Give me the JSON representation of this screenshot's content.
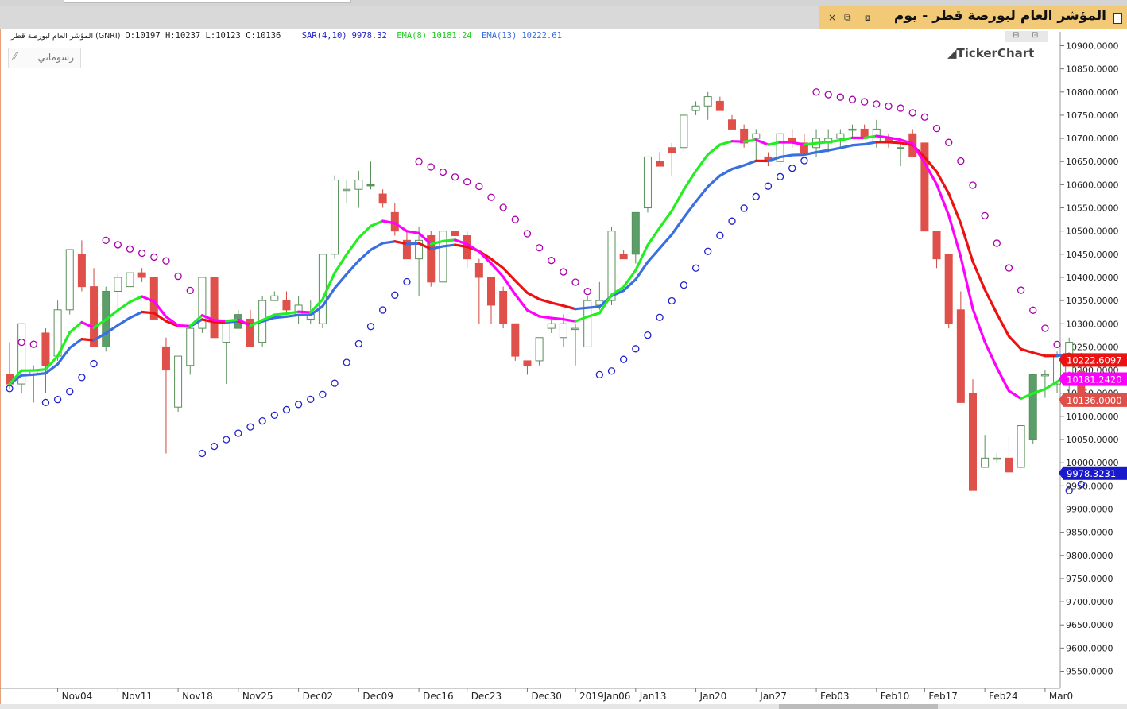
{
  "window": {
    "title": "المؤشر العام لبورصة قطر - يوم",
    "controls": [
      "×",
      "⧉",
      "⧈",
      "⊟",
      "⊡"
    ]
  },
  "legend": {
    "instrument": "المؤشر العام لبورصة قطر (GNRI)",
    "ohlc": "O:10197  H:10237  L:10123  C:10136",
    "sar_label": "SAR(4,10)",
    "sar_value": "9978.32",
    "ema8_label": "EMA(8)",
    "ema8_value": "10181.24",
    "ema13_label": "EMA(13)",
    "ema13_value": "10222.61"
  },
  "toolbar": {
    "drawings_label": "رسوماتي",
    "drawings_icon": "trend-line-icon"
  },
  "brand": "TickerChart",
  "colors": {
    "up_candle": "#2e8b2e",
    "down_candle": "#e0504a",
    "ema8_rising": "#22ee22",
    "ema8_falling": "#ff00ff",
    "ema13_rising": "#3a6fe0",
    "ema13_falling": "#ee1111",
    "sar_below": "#2020cc",
    "sar_above": "#aa00aa"
  },
  "chart_data": {
    "type": "candlestick",
    "title": "المؤشر العام لبورصة قطر - يوم",
    "y_axis_side": "right",
    "ylim": [
      9520,
      10930
    ],
    "y_ticks": [
      10900,
      10850,
      10800,
      10750,
      10700,
      10650,
      10600,
      10550,
      10500,
      10450,
      10400,
      10350,
      10300,
      10250,
      10200,
      10150,
      10100,
      10050,
      10000,
      9950,
      9900,
      9850,
      9800,
      9750,
      9700,
      9650,
      9600,
      9550
    ],
    "x_ticks": [
      {
        "label": "Nov04",
        "bar": 4.5
      },
      {
        "label": "Nov11",
        "bar": 9.5
      },
      {
        "label": "Nov18",
        "bar": 14.5
      },
      {
        "label": "Nov25",
        "bar": 19.5
      },
      {
        "label": "Dec02",
        "bar": 24.5
      },
      {
        "label": "Dec09",
        "bar": 29.5
      },
      {
        "label": "Dec16",
        "bar": 34.5
      },
      {
        "label": "Dec23",
        "bar": 38.5
      },
      {
        "label": "Dec30",
        "bar": 43.5
      },
      {
        "label": "2019Jan06",
        "bar": 47.5
      },
      {
        "label": "Jan13",
        "bar": 52.5
      },
      {
        "label": "Jan20",
        "bar": 57.5
      },
      {
        "label": "Jan27",
        "bar": 62.5
      },
      {
        "label": "Feb03",
        "bar": 67.5
      },
      {
        "label": "Feb10",
        "bar": 72.5
      },
      {
        "label": "Feb17",
        "bar": 76.5
      },
      {
        "label": "Feb24",
        "bar": 81.5
      },
      {
        "label": "Mar0",
        "bar": 86.5
      }
    ],
    "candles": [
      [
        10190,
        10260,
        10160,
        10170
      ],
      [
        10170,
        10300,
        10150,
        10300
      ],
      [
        10190,
        10210,
        10130,
        10200
      ],
      [
        10280,
        10290,
        10150,
        10210
      ],
      [
        10230,
        10350,
        10220,
        10330
      ],
      [
        10330,
        10460,
        10320,
        10460
      ],
      [
        10450,
        10480,
        10370,
        10380
      ],
      [
        10380,
        10420,
        10250,
        10250
      ],
      [
        10250,
        10380,
        10240,
        10370
      ],
      [
        10370,
        10410,
        10330,
        10400
      ],
      [
        10380,
        10400,
        10370,
        10410
      ],
      [
        10410,
        10420,
        10390,
        10400
      ],
      [
        10400,
        10400,
        10310,
        10310
      ],
      [
        10250,
        10270,
        10020,
        10200
      ],
      [
        10120,
        10230,
        10110,
        10230
      ],
      [
        10210,
        10300,
        10190,
        10290
      ],
      [
        10290,
        10400,
        10280,
        10400
      ],
      [
        10400,
        10400,
        10270,
        10270
      ],
      [
        10260,
        10300,
        10170,
        10300
      ],
      [
        10290,
        10330,
        10290,
        10320
      ],
      [
        10310,
        10330,
        10250,
        10250
      ],
      [
        10260,
        10360,
        10250,
        10350
      ],
      [
        10350,
        10370,
        10350,
        10360
      ],
      [
        10350,
        10370,
        10320,
        10330
      ],
      [
        10320,
        10360,
        10300,
        10340
      ],
      [
        10310,
        10350,
        10300,
        10320
      ],
      [
        10300,
        10400,
        10290,
        10450
      ],
      [
        10450,
        10620,
        10440,
        10610
      ],
      [
        10590,
        10610,
        10560,
        10590
      ],
      [
        10590,
        10630,
        10550,
        10610
      ],
      [
        10600,
        10650,
        10590,
        10600
      ],
      [
        10580,
        10590,
        10550,
        10560
      ],
      [
        10540,
        10560,
        10490,
        10500
      ],
      [
        10480,
        10500,
        10440,
        10440
      ],
      [
        10440,
        10510,
        10360,
        10480
      ],
      [
        10490,
        10500,
        10380,
        10390
      ],
      [
        10390,
        10500,
        10390,
        10500
      ],
      [
        10500,
        10510,
        10470,
        10490
      ],
      [
        10490,
        10500,
        10420,
        10440
      ],
      [
        10430,
        10440,
        10300,
        10400
      ],
      [
        10400,
        10340,
        10300,
        10340
      ],
      [
        10370,
        10380,
        10290,
        10300
      ],
      [
        10300,
        10300,
        10220,
        10230
      ],
      [
        10220,
        10220,
        10190,
        10210
      ],
      [
        10220,
        10270,
        10210,
        10270
      ],
      [
        10290,
        10310,
        10280,
        10300
      ],
      [
        10270,
        10320,
        10250,
        10300
      ],
      [
        10290,
        10300,
        10210,
        10290
      ],
      [
        10250,
        10360,
        10250,
        10350
      ],
      [
        10340,
        10390,
        10330,
        10350
      ],
      [
        10350,
        10510,
        10340,
        10500
      ],
      [
        10450,
        10460,
        10440,
        10440
      ],
      [
        10450,
        10540,
        10430,
        10540
      ],
      [
        10550,
        10640,
        10540,
        10660
      ],
      [
        10650,
        10670,
        10640,
        10640
      ],
      [
        10680,
        10690,
        10620,
        10670
      ],
      [
        10680,
        10750,
        10670,
        10750
      ],
      [
        10760,
        10780,
        10750,
        10770
      ],
      [
        10770,
        10800,
        10740,
        10790
      ],
      [
        10780,
        10790,
        10760,
        10760
      ],
      [
        10740,
        10750,
        10720,
        10720
      ],
      [
        10720,
        10730,
        10680,
        10690
      ],
      [
        10700,
        10720,
        10650,
        10710
      ],
      [
        10660,
        10670,
        10640,
        10650
      ],
      [
        10650,
        10710,
        10640,
        10710
      ],
      [
        10700,
        10720,
        10680,
        10690
      ],
      [
        10690,
        10710,
        10680,
        10670
      ],
      [
        10680,
        10720,
        10660,
        10700
      ],
      [
        10690,
        10720,
        10670,
        10700
      ],
      [
        10700,
        10720,
        10680,
        10710
      ],
      [
        10720,
        10730,
        10700,
        10720
      ],
      [
        10720,
        10730,
        10700,
        10700
      ],
      [
        10690,
        10740,
        10680,
        10720
      ],
      [
        10700,
        10710,
        10680,
        10690
      ],
      [
        10680,
        10700,
        10640,
        10680
      ],
      [
        10710,
        10720,
        10660,
        10660
      ],
      [
        10690,
        10690,
        10500,
        10500
      ],
      [
        10500,
        10450,
        10420,
        10440
      ],
      [
        10450,
        10450,
        10290,
        10300
      ],
      [
        10330,
        10370,
        10200,
        10130
      ],
      [
        10150,
        10180,
        9940,
        9940
      ],
      [
        9990,
        10060,
        9990,
        10010
      ],
      [
        10010,
        10020,
        10000,
        10010
      ],
      [
        10010,
        10060,
        9980,
        9980
      ],
      [
        9990,
        10080,
        9990,
        10080
      ],
      [
        10050,
        10190,
        10040,
        10190
      ],
      [
        10190,
        10200,
        10140,
        10190
      ],
      [
        10170,
        10240,
        10150,
        10230
      ],
      [
        10170,
        10270,
        10150,
        10260
      ],
      [
        10197,
        10237,
        10123,
        10136
      ]
    ],
    "series": [
      {
        "name": "EMA(8)",
        "last": 10181.242
      },
      {
        "name": "EMA(13)",
        "last": 10222.6097
      },
      {
        "name": "SAR(4,10)",
        "last": 9978.3231
      }
    ],
    "price_labels": [
      {
        "text": "10222.6097",
        "value": 10222.6097,
        "color": "#ee1111"
      },
      {
        "text": "10181.2420",
        "value": 10181.242,
        "color": "#ff00ff"
      },
      {
        "text": "10136.0000",
        "value": 10136,
        "color": "#e0504a"
      },
      {
        "text": "9978.3231",
        "value": 9978.3231,
        "color": "#1a1acc"
      }
    ]
  }
}
